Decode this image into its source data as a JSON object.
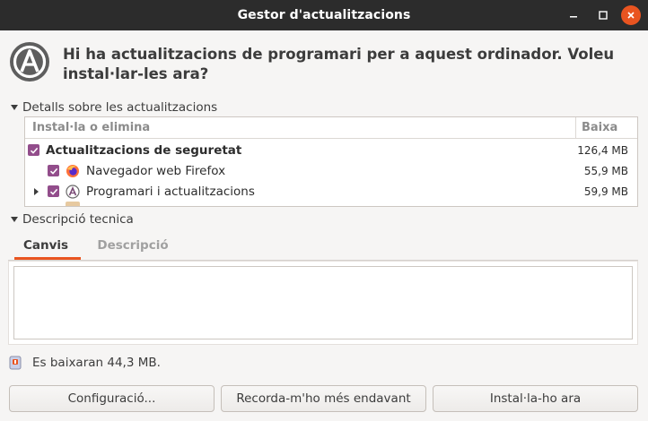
{
  "window": {
    "title": "Gestor d'actualitzacions"
  },
  "header": {
    "icon": "software-updater-icon",
    "message": "Hi ha actualitzacions de programari per a aquest ordinador. Voleu instal·lar-les ara?"
  },
  "details": {
    "expander_label": "Detalls sobre les actualitzacions",
    "columns": {
      "name": "Instal·la o elimina",
      "download": "Baixa"
    },
    "rows": [
      {
        "label": "Actualitzacions de seguretat",
        "size": "126,4 MB",
        "checked": true,
        "bold": true
      },
      {
        "label": "Navegador web Firefox",
        "size": "55,9 MB",
        "checked": true,
        "icon": "firefox-icon"
      },
      {
        "label": "Programari i actualitzacions",
        "size": "59,9 MB",
        "checked": true,
        "icon": "software-properties-icon",
        "expandable": true
      }
    ]
  },
  "description": {
    "expander_label": "Descripció tecnica",
    "tabs": [
      {
        "label": "Canvis",
        "active": true
      },
      {
        "label": "Descripció",
        "active": false
      }
    ],
    "text": ""
  },
  "status": {
    "icon": "download-info-icon",
    "text": "Es baixaran 44,3 MB."
  },
  "buttons": {
    "settings": "Configuració...",
    "remind_later": "Recorda-m'ho més endavant",
    "install_now": "Instal·la-ho ara"
  },
  "colors": {
    "titlebar": "#2c2c2c",
    "accent": "#e95420",
    "checkbox": "#924d8b"
  }
}
